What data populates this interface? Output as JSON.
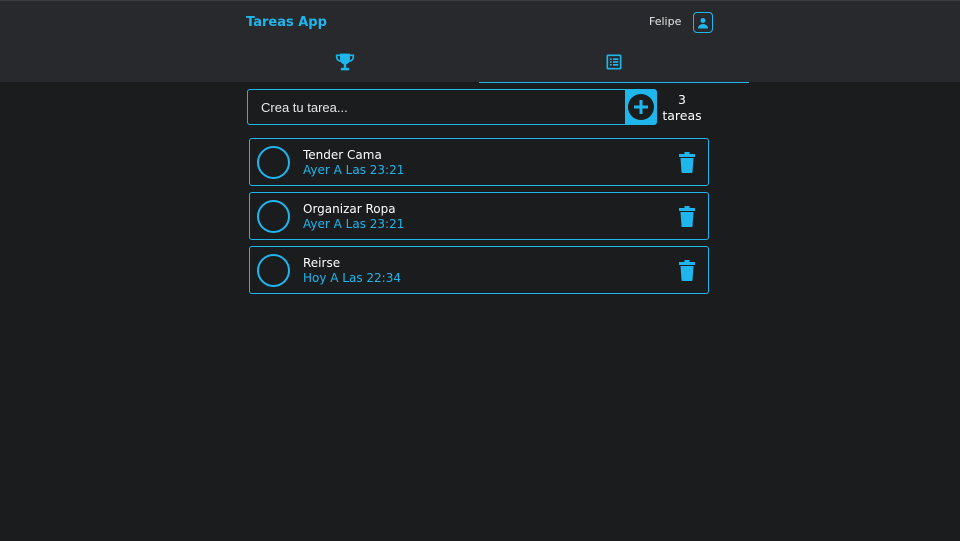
{
  "header": {
    "brand": "Tareas App",
    "user_name": "Felipe",
    "avatar_icon": "user-icon"
  },
  "tabs": [
    {
      "icon": "trophy-icon",
      "active": false
    },
    {
      "icon": "list-icon",
      "active": true
    }
  ],
  "new_task": {
    "placeholder": "Crea tu tarea...",
    "value": "",
    "add_icon": "plus-circle-icon"
  },
  "count": {
    "number": "3",
    "label": "tareas"
  },
  "tasks": [
    {
      "title": "Tender Cama",
      "time": "Ayer A Las 23:21"
    },
    {
      "title": "Organizar Ropa",
      "time": "Ayer A Las 23:21"
    },
    {
      "title": "Reirse",
      "time": "Hoy A Las 22:34"
    }
  ],
  "colors": {
    "accent": "#1fb6ee",
    "background": "#1b1c1e",
    "header_bg": "#27292c"
  }
}
